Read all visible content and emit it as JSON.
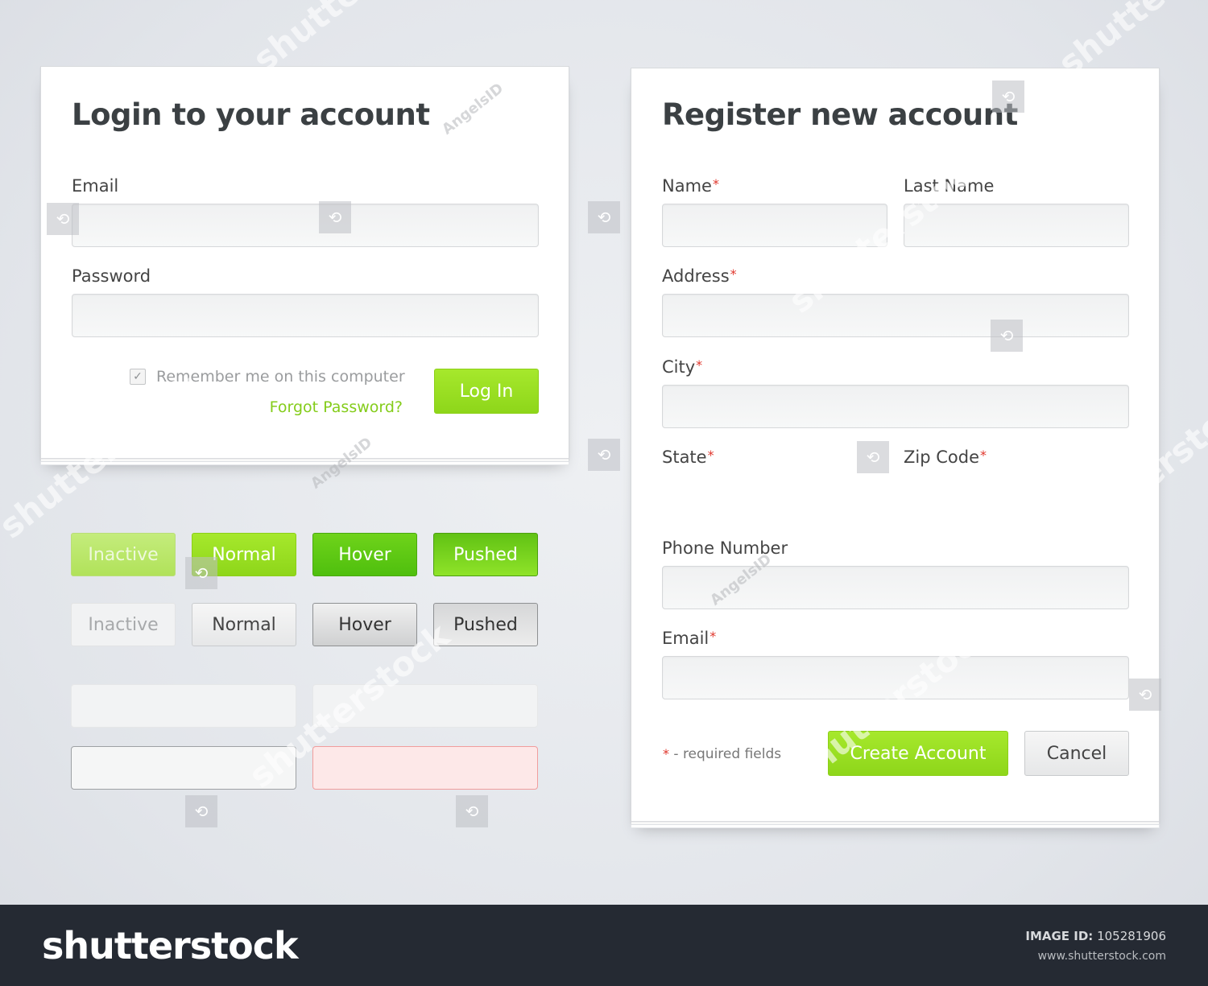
{
  "login": {
    "title": "Login to your account",
    "email_label": "Email",
    "password_label": "Password",
    "remember_label": "Remember me on this computer",
    "remember_checked": true,
    "forgot_link": "Forgot Password?",
    "login_button": "Log In"
  },
  "button_states": {
    "green": [
      "Inactive",
      "Normal",
      "Hover",
      "Pushed"
    ],
    "gray": [
      "Inactive",
      "Normal",
      "Hover",
      "Pushed"
    ]
  },
  "register": {
    "title": "Register new account",
    "name_label": "Name",
    "last_name_label": "Last Name",
    "address_label": "Address",
    "city_label": "City",
    "state_label": "State",
    "zip_label": "Zip Code",
    "phone_label": "Phone Number",
    "email_label": "Email",
    "required_mark": "*",
    "required_note": "- required fields",
    "create_button": "Create Account",
    "cancel_button": "Cancel"
  },
  "footer": {
    "logo": "shutterstock",
    "image_id_label": "IMAGE ID:",
    "image_id": "105281906",
    "site": "www.shutterstock.com"
  },
  "watermarks": {
    "stock": "shutterstock",
    "artist": "AngelsID"
  },
  "colors": {
    "accent_green": "#8ed61a",
    "required_red": "#e0362c",
    "title_text": "#3b4043",
    "footer_bg": "#252a33"
  }
}
